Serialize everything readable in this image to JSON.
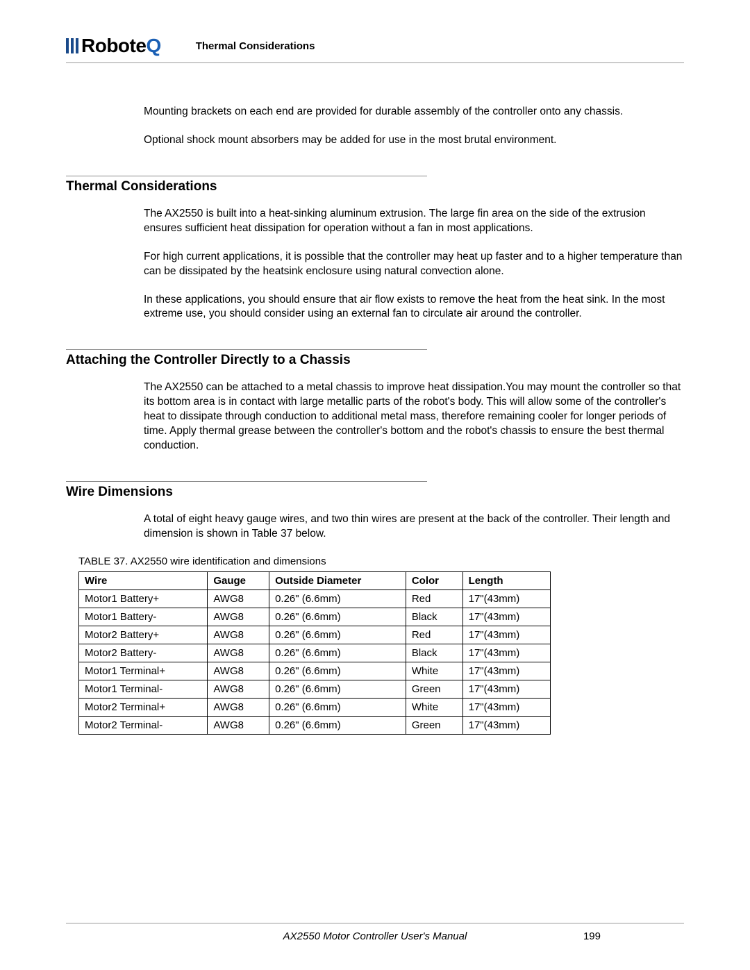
{
  "header": {
    "logo_text": "Robote",
    "logo_q": "Q",
    "title": "Thermal Considerations"
  },
  "intro": {
    "p1": "Mounting brackets on each end are provided for durable assembly of the controller onto any chassis.",
    "p2": "Optional shock mount absorbers may be added for use in the most brutal environment."
  },
  "sections": {
    "thermal": {
      "title": "Thermal Considerations",
      "p1": "The AX2550 is built into a heat-sinking aluminum extrusion. The large fin area on the side of the extrusion ensures sufficient heat dissipation for operation without a fan in most applications.",
      "p2": "For high current applications, it is possible that the controller may heat up faster and to a higher temperature than can be dissipated by the heatsink enclosure using natural convection alone.",
      "p3": "In these applications, you should ensure that air flow exists to remove the heat from the heat sink. In the most extreme use, you should consider using an external fan to circulate air around the controller."
    },
    "attaching": {
      "title": "Attaching the Controller Directly to a Chassis",
      "p1": "The AX2550 can be attached to a metal chassis to improve heat dissipation.You may mount the controller so that its bottom area is in contact with large metallic parts of the robot's body. This will allow some of the controller's heat to dissipate through conduction to additional metal mass, therefore remaining cooler for longer periods of time. Apply thermal grease between the controller's bottom and the robot's chassis to ensure the best thermal conduction."
    },
    "wire": {
      "title": "Wire Dimensions",
      "p1": "A total of eight heavy gauge wires, and two thin wires are present at the back of the controller. Their length and dimension is shown in Table 37 below.",
      "table_caption": "TABLE 37. AX2550 wire identification and dimensions",
      "headers": {
        "c0": "Wire",
        "c1": "Gauge",
        "c2": "Outside Diameter",
        "c3": "Color",
        "c4": "Length"
      },
      "rows": [
        {
          "c0": "Motor1 Battery+",
          "c1": "AWG8",
          "c2": "0.26\" (6.6mm)",
          "c3": "Red",
          "c4": "17\"(43mm)"
        },
        {
          "c0": "Motor1 Battery-",
          "c1": "AWG8",
          "c2": "0.26\" (6.6mm)",
          "c3": "Black",
          "c4": "17\"(43mm)"
        },
        {
          "c0": "Motor2 Battery+",
          "c1": "AWG8",
          "c2": "0.26\" (6.6mm)",
          "c3": "Red",
          "c4": "17\"(43mm)"
        },
        {
          "c0": "Motor2 Battery-",
          "c1": "AWG8",
          "c2": "0.26\" (6.6mm)",
          "c3": "Black",
          "c4": "17\"(43mm)"
        },
        {
          "c0": "Motor1 Terminal+",
          "c1": "AWG8",
          "c2": "0.26\" (6.6mm)",
          "c3": "White",
          "c4": "17\"(43mm)"
        },
        {
          "c0": "Motor1 Terminal-",
          "c1": "AWG8",
          "c2": "0.26\" (6.6mm)",
          "c3": "Green",
          "c4": "17\"(43mm)"
        },
        {
          "c0": "Motor2 Terminal+",
          "c1": "AWG8",
          "c2": "0.26\" (6.6mm)",
          "c3": "White",
          "c4": "17\"(43mm)"
        },
        {
          "c0": "Motor2 Terminal-",
          "c1": "AWG8",
          "c2": "0.26\" (6.6mm)",
          "c3": "Green",
          "c4": "17\"(43mm)"
        }
      ]
    }
  },
  "footer": {
    "title": "AX2550 Motor Controller User's Manual",
    "page": "199"
  }
}
